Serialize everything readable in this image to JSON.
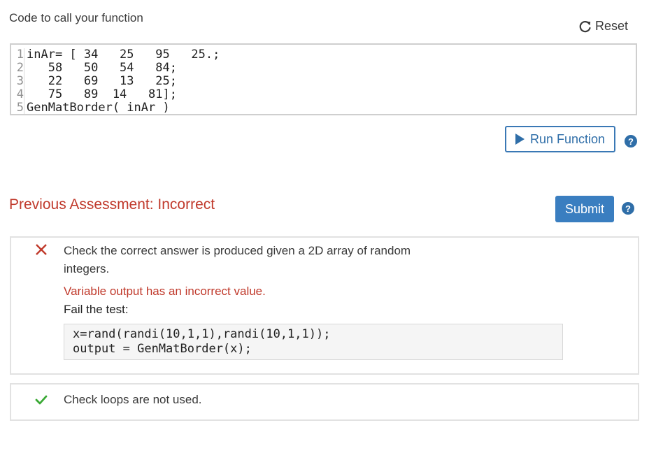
{
  "header": {
    "section_title": "Code to call your function",
    "reset_label": "Reset"
  },
  "editor": {
    "line_numbers": [
      "1",
      "2",
      "3",
      "4",
      "5"
    ],
    "lines": [
      "inAr= [ 34   25   95   25.;",
      "   58   50   54   84;",
      "   22   69   13   25;",
      "   75   89  14   81];",
      "GenMatBorder( inAr )"
    ]
  },
  "actions": {
    "run_label": "Run Function",
    "submit_label": "Submit",
    "help_symbol": "?"
  },
  "assessment": {
    "title": "Previous Assessment: Incorrect",
    "tests": [
      {
        "status": "fail",
        "status_icon": "x-icon",
        "description": "Check the correct answer is produced given a 2D array of random integers.",
        "message": "Variable output has an incorrect value.",
        "result_label": "Fail the test:",
        "code": [
          "x=rand(randi(10,1,1),randi(10,1,1));",
          "output = GenMatBorder(x);"
        ]
      },
      {
        "status": "pass",
        "status_icon": "check-icon",
        "description": "Check loops are not used."
      }
    ]
  },
  "colors": {
    "error": "#c0392b",
    "success": "#3aa935",
    "primary": "#3a7ec0"
  }
}
